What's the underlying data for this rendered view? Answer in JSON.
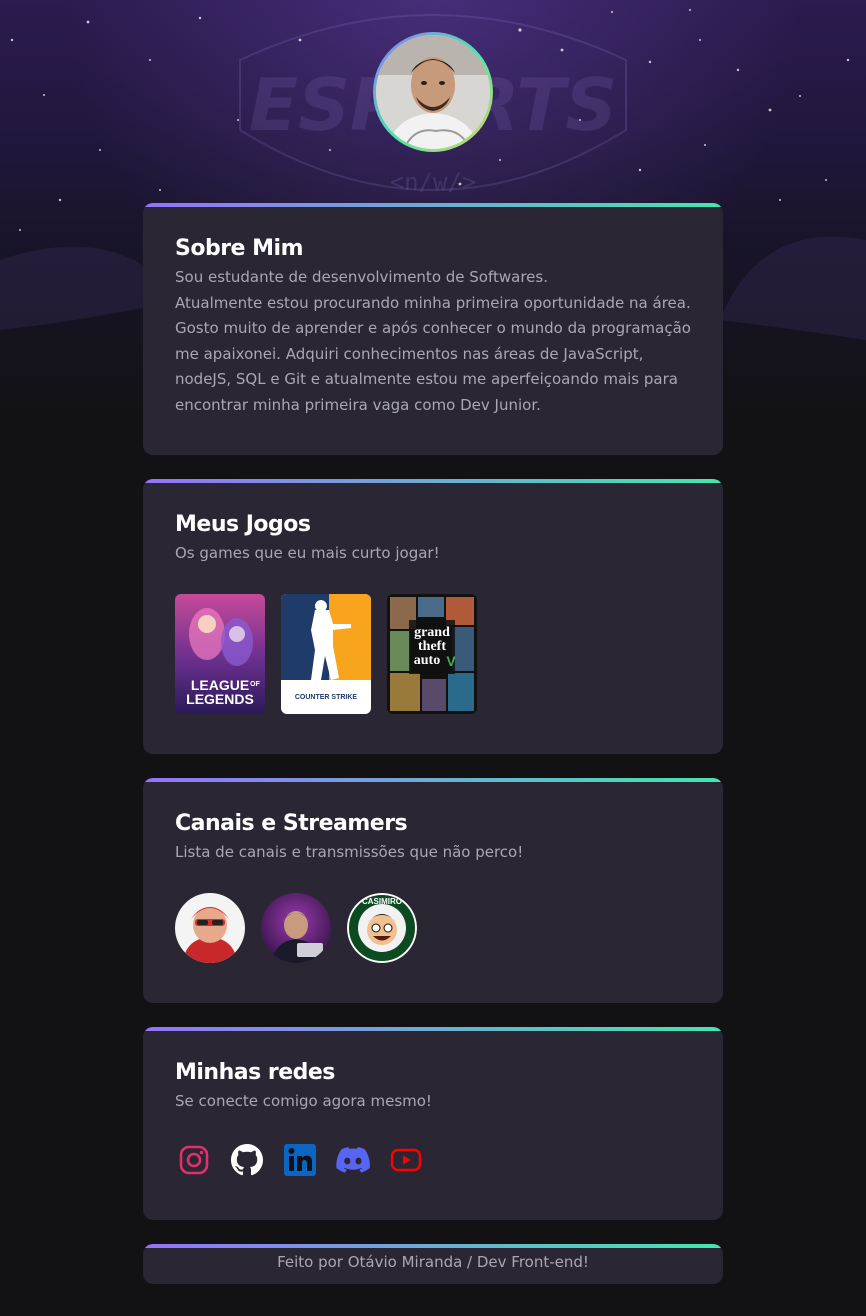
{
  "profile": {
    "avatar_alt": "Foto de perfil"
  },
  "hero": {
    "watermark_text": "ESPORTS",
    "watermark_sub": "<n/w/>"
  },
  "about": {
    "title": "Sobre Mim",
    "lines": [
      "Sou estudante de desenvolvimento de Softwares.",
      "Atualmente estou procurando minha primeira oportunidade na área.",
      "Gosto muito de aprender e após conhecer o mundo da programação",
      "me apaixonei. Adquiri conhecimentos nas áreas de JavaScript,",
      "nodeJS, SQL e Git e atualmente estou me aperfeiçoando mais para",
      "encontrar minha primeira vaga como Dev Junior."
    ]
  },
  "games": {
    "title": "Meus Jogos",
    "subtitle": "Os games que eu mais curto jogar!",
    "items": [
      {
        "name": "League of Legends",
        "logo_line1": "LEAGUE",
        "logo_of": "OF",
        "logo_line2": "LEGENDS"
      },
      {
        "name": "Counter-Strike",
        "logo_text": "COUNTER STRIKE"
      },
      {
        "name": "Grand Theft Auto V",
        "logo_line1": "grand",
        "logo_line2": "theft",
        "logo_line3": "auto",
        "logo_v": "V"
      }
    ]
  },
  "streamers": {
    "title": "Canais e Streamers",
    "subtitle": "Lista de canais e transmissões que não perco!",
    "items": [
      {
        "name": "streamer-1"
      },
      {
        "name": "streamer-2"
      },
      {
        "name": "casimiro",
        "badge_text": "CASIMIRO"
      }
    ]
  },
  "socials": {
    "title": "Minhas redes",
    "subtitle": "Se conecte comigo agora mesmo!",
    "items": [
      {
        "name": "instagram",
        "icon": "instagram-icon",
        "color": "#e1306c"
      },
      {
        "name": "github",
        "icon": "github-icon",
        "color": "#ffffff"
      },
      {
        "name": "linkedin",
        "icon": "linkedin-icon",
        "color": "#0a66c2"
      },
      {
        "name": "discord",
        "icon": "discord-icon",
        "color": "#5865f2"
      },
      {
        "name": "youtube",
        "icon": "youtube-icon",
        "color": "#ff0000"
      }
    ]
  },
  "footer": {
    "text": "Feito por Otávio Miranda / Dev Front-end!"
  }
}
